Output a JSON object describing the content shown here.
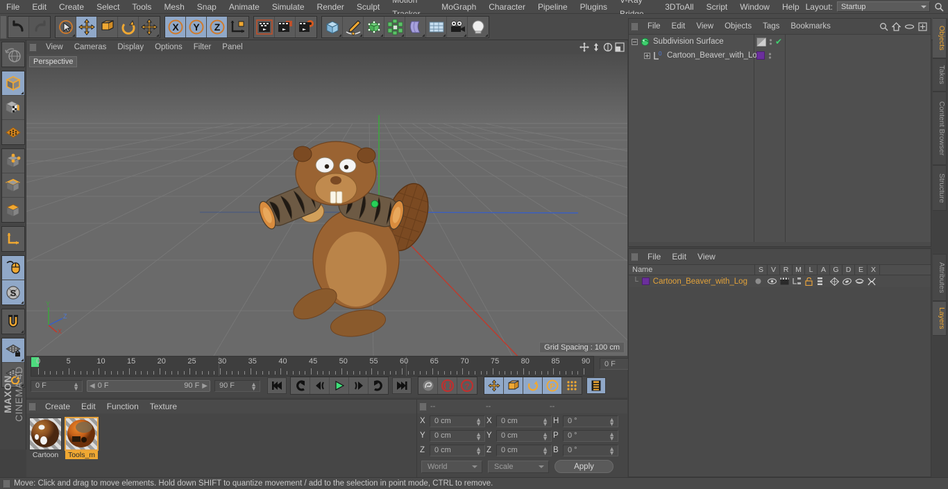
{
  "app": {
    "name": "MAXON CINEMA 4D",
    "logo_top": "MAXON",
    "logo_bottom": "CINEMA 4D"
  },
  "menubar": {
    "items": [
      "File",
      "Edit",
      "Create",
      "Select",
      "Tools",
      "Mesh",
      "Snap",
      "Animate",
      "Simulate",
      "Render",
      "Sculpt",
      "Motion Tracker",
      "MoGraph",
      "Character",
      "Pipeline",
      "Plugins",
      "V-Ray Bridge",
      "3DToAll",
      "Script",
      "Window",
      "Help"
    ],
    "layout_label": "Layout:",
    "layout_value": "Startup",
    "search_icon": "search-icon"
  },
  "toolbar": {
    "undo": "undo-icon",
    "redo": "redo-icon",
    "select": "select-cursor-icon",
    "move": "move-tool-icon",
    "scale": "scale-tool-icon",
    "rotate": "rotate-tool-icon",
    "move_axis": "move-axis-icon",
    "lock_x": "X",
    "lock_y": "Y",
    "lock_z": "Z",
    "world_object": "world-coordinate-icon",
    "render_view": "render-view-icon",
    "render_region": "render-to-picture-viewer-icon",
    "render_settings": "render-settings-icon",
    "cube": "primitive-cube-icon",
    "spline": "spline-pen-icon",
    "generator": "generator-icon",
    "mograph": "mograph-cloner-icon",
    "deformer": "bend-deformer-icon",
    "scene": "scene-floor-icon",
    "camera": "camera-icon",
    "light": "light-icon"
  },
  "lefttools": {
    "items": [
      {
        "name": "undo-view-icon",
        "label": "Undo View"
      },
      {
        "name": "model-mode-icon",
        "label": "Model Mode",
        "selected": true
      },
      {
        "name": "texture-mode-icon",
        "label": "Texture Mode"
      },
      {
        "name": "polygon-mode-icon",
        "label": "Polygon Mode"
      },
      {
        "name": "point-mode-icon",
        "label": "Points Mode"
      },
      {
        "name": "edge-mode-icon",
        "label": "Edge Mode"
      },
      {
        "name": "face-mode-icon",
        "label": "Face Mode"
      },
      {
        "name": "axis-mode-icon",
        "label": "Enable Axis Modification"
      },
      {
        "name": "viewport-solo-icon",
        "label": "Viewport Solo",
        "selected": true
      },
      {
        "name": "enable-snap-icon",
        "label": "Enable Snapping",
        "selected": true
      },
      {
        "name": "magnet-icon",
        "label": "Magnet"
      },
      {
        "name": "workplane-lock-icon",
        "label": "Lock Workplane",
        "selected": true
      },
      {
        "name": "workplane-rotate-icon",
        "label": "Planar Workplane"
      }
    ]
  },
  "viewport": {
    "menu": [
      "View",
      "Cameras",
      "Display",
      "Options",
      "Filter",
      "Panel"
    ],
    "label": "Perspective",
    "grid_spacing": "Grid Spacing : 100 cm",
    "axis": {
      "x": "X",
      "y": "Y",
      "z": "Z"
    },
    "icons": [
      "pan-icon",
      "dolly-icon",
      "orbit-icon",
      "maximize-viewport-icon"
    ]
  },
  "timeline": {
    "ticks": [
      0,
      5,
      10,
      15,
      20,
      25,
      30,
      35,
      40,
      45,
      50,
      55,
      60,
      65,
      70,
      75,
      80,
      85,
      90
    ],
    "current_frame_field": "0 F",
    "start_field": "0 F",
    "range_start": "0 F",
    "range_end": "90 F",
    "end_field": "90 F",
    "transport": [
      {
        "name": "go-to-start-button",
        "glyph": "|◀◀"
      },
      {
        "name": "play-backwards-loop-button",
        "glyph": "↺"
      },
      {
        "name": "step-back-button",
        "glyph": "◀("
      },
      {
        "name": "play-button",
        "glyph": "▶"
      },
      {
        "name": "step-forward-button",
        "glyph": ")▶"
      },
      {
        "name": "loop-button",
        "glyph": "↻"
      },
      {
        "name": "go-to-end-button",
        "glyph": "▶▶|"
      }
    ],
    "record_tools": [
      {
        "name": "autokey-button"
      },
      {
        "name": "record-active-objects-button"
      },
      {
        "name": "keyframe-selection-button"
      }
    ],
    "key_toggles": [
      {
        "name": "record-position-button",
        "selected": true
      },
      {
        "name": "record-scale-button",
        "selected": true
      },
      {
        "name": "record-rotation-button",
        "selected": true
      },
      {
        "name": "record-parameter-button",
        "selected": true
      },
      {
        "name": "record-pla-button",
        "selected": false
      },
      {
        "name": "timeline-button",
        "selected": true
      }
    ]
  },
  "materials": {
    "menu": [
      "Create",
      "Edit",
      "Function",
      "Texture"
    ],
    "items": [
      {
        "name": "Cartoon",
        "selected": false
      },
      {
        "name": "Tools_m",
        "selected": true
      }
    ]
  },
  "coordinates": {
    "headers": [
      "--",
      "--",
      "--"
    ],
    "position": [
      {
        "label": "X",
        "value": "0 cm"
      },
      {
        "label": "Y",
        "value": "0 cm"
      },
      {
        "label": "Z",
        "value": "0 cm"
      }
    ],
    "size": [
      {
        "label": "X",
        "value": "0 cm"
      },
      {
        "label": "Y",
        "value": "0 cm"
      },
      {
        "label": "Z",
        "value": "0 cm"
      }
    ],
    "rotation": [
      {
        "label": "H",
        "value": "0 °"
      },
      {
        "label": "P",
        "value": "0 °"
      },
      {
        "label": "B",
        "value": "0 °"
      }
    ],
    "coord_system": "World",
    "size_mode": "Scale",
    "apply_label": "Apply"
  },
  "object_manager": {
    "menu": [
      "File",
      "Edit",
      "View",
      "Objects",
      "Tags",
      "Bookmarks"
    ],
    "icons": [
      "search-icon",
      "home-icon",
      "ellipse-icon",
      "add-layer-icon"
    ],
    "objects": [
      {
        "name": "Subdivision Surface",
        "icon": "subdivision-surface-icon",
        "enabled_check": "✔",
        "expander": "minus"
      },
      {
        "name": "Cartoon_Beaver_with_Log",
        "icon": "null-object-icon",
        "tag_color": "#6b2f9c",
        "expander": "plus",
        "layer_badge": "0"
      }
    ]
  },
  "layer_manager": {
    "menu": [
      "File",
      "Edit",
      "View"
    ],
    "columns": [
      "Name",
      "S",
      "V",
      "R",
      "M",
      "L",
      "A",
      "G",
      "D",
      "E",
      "X"
    ],
    "rows": [
      {
        "name": "Cartoon_Beaver_with_Log",
        "swatch": "#6b2f9c",
        "icons": [
          "solo-dot-icon",
          "visible-eye-icon",
          "render-clapper-icon",
          "manager-icon",
          "unlock-icon",
          "animation-icon",
          "generator-icon",
          "deformer-icon",
          "expression-icon",
          "xref-icon"
        ]
      }
    ]
  },
  "right_tabs": [
    {
      "label": "Objects",
      "active": true
    },
    {
      "label": "Takes",
      "active": false
    },
    {
      "label": "Content Browser",
      "active": false
    },
    {
      "label": "Structure",
      "active": false
    },
    {
      "label": "Attributes",
      "active": false
    },
    {
      "label": "Layers",
      "active": true
    }
  ],
  "statusbar": {
    "message": "Move: Click and drag to move elements. Hold down SHIFT to quantize movement / add to the selection in point mode, CTRL to remove."
  },
  "colors": {
    "accent_orange": "#f0a832",
    "selected_blue": "#90a8c8",
    "panel_bg": "#4a4a4a",
    "window_bg": "#414141",
    "green_marker": "#4ddb7e",
    "axis_x": "#c1392b",
    "axis_y": "#3fa33f",
    "axis_z": "#3b5fc0"
  }
}
